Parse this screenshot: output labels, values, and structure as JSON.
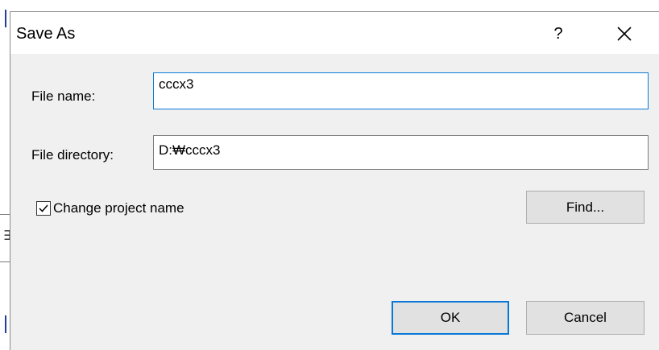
{
  "dialog": {
    "title": "Save As",
    "help_label": "?",
    "close_icon": "close-icon"
  },
  "form": {
    "file_name_label": "File name:",
    "file_name_value": "cccx3",
    "file_directory_label": "File directory:",
    "file_directory_value": "D:₩cccx3",
    "change_project_name_label": "Change project name",
    "change_project_name_checked": true
  },
  "buttons": {
    "find_label": "Find...",
    "ok_label": "OK",
    "cancel_label": "Cancel"
  },
  "colors": {
    "focus_border": "#0a78d7",
    "dialog_bg": "#f0f0f0",
    "button_bg": "#e1e1e1"
  }
}
